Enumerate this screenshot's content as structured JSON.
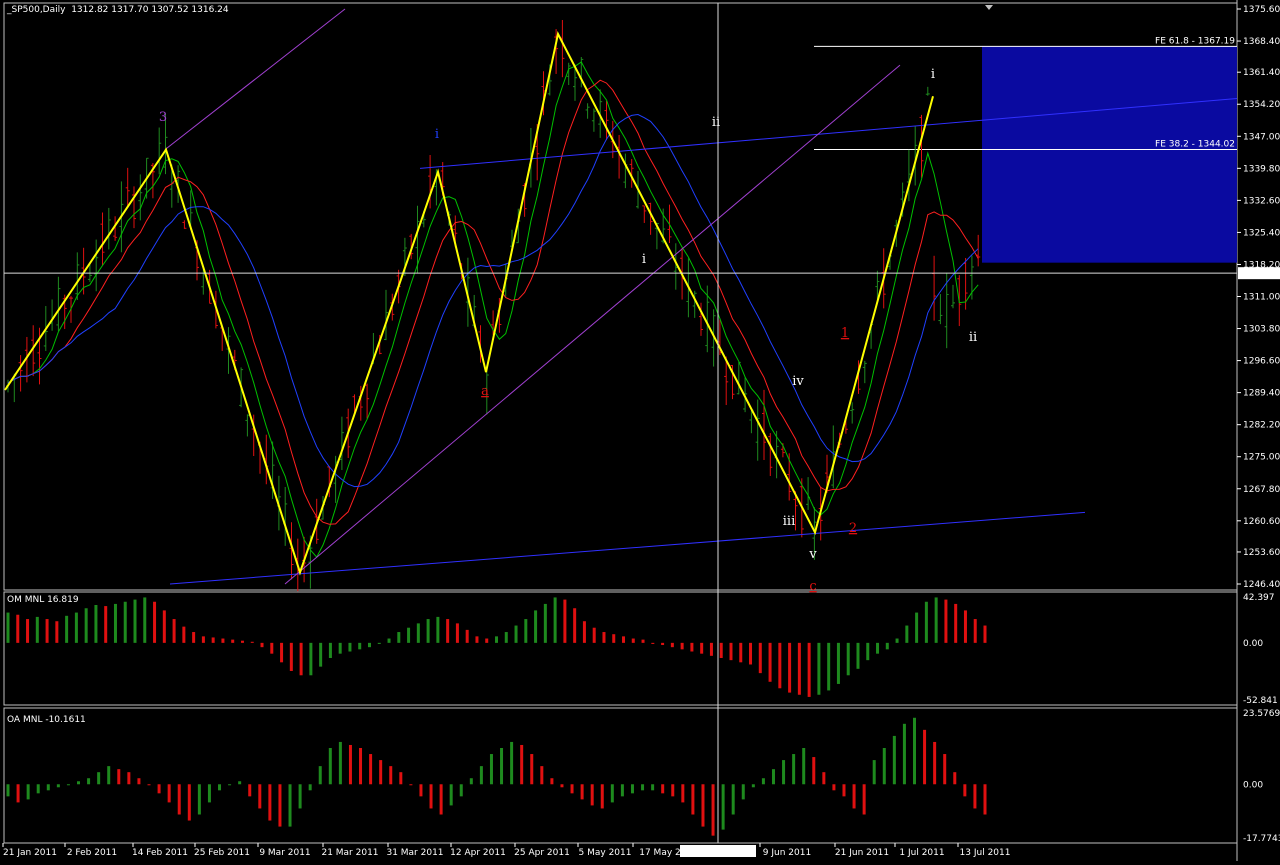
{
  "header": {
    "symbol": "_SP500,Daily",
    "ohlc": "1312.82 1317.70 1307.52 1316.24"
  },
  "indicators": {
    "om_label": "OM MNL 16.819",
    "oa_label": "OA MNL -10.1611"
  },
  "crosshair_time": "2011.05.31 0:00",
  "colors": {
    "background": "#000000",
    "frame": "#c0c0c0",
    "bull_bar": "#1f8a1f",
    "bear_bar": "#e01010",
    "zigzag": "#ffff00",
    "ma_fast": "#00c000",
    "ma_mid": "#ff2020",
    "ma_slow": "#2040ff",
    "channel": "#3030ff",
    "diagonal": "#a040d0",
    "fib_zone": "#0a0aa0",
    "hist_pos": "#1e8a1e",
    "hist_neg": "#e01010"
  },
  "chart_data": [
    {
      "type": "candlestick",
      "pane": "price",
      "title": "_SP500,Daily",
      "y_ticks": [
        "1375.60",
        "1368.40",
        "1361.40",
        "1354.20",
        "1347.00",
        "1339.80",
        "1332.60",
        "1325.40",
        "1318.20",
        "1311.00",
        "1303.80",
        "1296.60",
        "1289.40",
        "1282.20",
        "1275.00",
        "1267.80",
        "1260.60",
        "1253.60",
        "1246.40"
      ],
      "last_price": "1316.24",
      "x_ticks": [
        "21 Jan 2011",
        "2 Feb 2011",
        "14 Feb 2011",
        "25 Feb 2011",
        "9 Mar 2011",
        "21 Mar 2011",
        "31 Mar 2011",
        "12 Apr 2011",
        "25 Apr 2011",
        "5 May 2011",
        "17 May 2",
        "9 Jun 2011",
        "21 Jun 2011",
        "1 Jul 2011",
        "13 Jul 2011"
      ],
      "zigzag": [
        {
          "date": "19 Jan 2011",
          "price": 1290
        },
        {
          "date": "18 Feb 2011",
          "price": 1344
        },
        {
          "date": "16 Mar 2011",
          "price": 1249
        },
        {
          "date": "1 Apr 2011",
          "price": 1339
        },
        {
          "date": "18 Apr 2011",
          "price": 1294
        },
        {
          "date": "2 May 2011",
          "price": 1370
        },
        {
          "date": "16 Jun 2011",
          "price": 1258
        },
        {
          "date": "7 Jul 2011",
          "price": 1356
        }
      ],
      "fibonacci": [
        {
          "label": "FE 61.8 - 1367.19",
          "price": 1367.19
        },
        {
          "label": "FE 38.2 - 1344.02",
          "price": 1344.02
        }
      ],
      "wave_labels": [
        {
          "text": "3",
          "color": "#a040d0"
        },
        {
          "text": "i",
          "color": "#2040ff"
        },
        {
          "text": "a",
          "color": "#e01010"
        },
        {
          "text": "ii",
          "color": "#ffffff"
        },
        {
          "text": "i",
          "color": "#ffffff"
        },
        {
          "text": "iv",
          "color": "#ffffff"
        },
        {
          "text": "iii",
          "color": "#ffffff"
        },
        {
          "text": "v",
          "color": "#ffffff"
        },
        {
          "text": "1",
          "color": "#e01010"
        },
        {
          "text": "2",
          "color": "#e01010"
        },
        {
          "text": "c",
          "color": "#e01010"
        },
        {
          "text": "i",
          "color": "#ffffff"
        },
        {
          "text": "ii",
          "color": "#ffffff"
        }
      ],
      "series": [
        {
          "values": []
        },
        {
          "values": []
        },
        {
          "values": []
        }
      ]
    },
    {
      "type": "bar",
      "pane": "OM",
      "title": "OM MNL 16.819",
      "y_ticks": [
        "42.397",
        "0.00",
        "-52.841"
      ],
      "ylim": [
        -52.841,
        42.397
      ],
      "values": [
        28,
        26,
        22,
        24,
        22,
        20,
        25,
        28,
        32,
        35,
        34,
        36,
        38,
        40,
        42,
        38,
        30,
        22,
        15,
        10,
        6,
        5,
        4,
        3,
        2,
        1,
        -4,
        -10,
        -18,
        -26,
        -30,
        -30,
        -22,
        -14,
        -10,
        -8,
        -6,
        -4,
        -1,
        4,
        10,
        14,
        18,
        22,
        24,
        22,
        18,
        12,
        6,
        4,
        6,
        10,
        16,
        22,
        30,
        36,
        42,
        40,
        32,
        20,
        14,
        10,
        8,
        6,
        4,
        3,
        -1,
        -2,
        -4,
        -6,
        -8,
        -10,
        -12,
        -14,
        -16,
        -18,
        -20,
        -28,
        -36,
        -42,
        -46,
        -48,
        -50,
        -48,
        -44,
        -38,
        -30,
        -24,
        -16,
        -10,
        -6,
        4,
        16,
        28,
        38,
        42,
        40,
        36,
        30,
        22,
        16
      ]
    },
    {
      "type": "bar",
      "pane": "OA",
      "title": "OA MNL -10.1611",
      "y_ticks": [
        "23.5769",
        "0.00",
        "-17.7743"
      ],
      "ylim": [
        -17.7743,
        23.5769
      ],
      "values": [
        -4,
        -6,
        -5,
        -3,
        -2,
        -1,
        0,
        1,
        2,
        4,
        6,
        5,
        4,
        2,
        0,
        -3,
        -6,
        -10,
        -12,
        -10,
        -6,
        -2,
        0,
        1,
        -4,
        -8,
        -12,
        -14,
        -14,
        -8,
        -2,
        6,
        12,
        14,
        13,
        12,
        10,
        8,
        6,
        4,
        0,
        -4,
        -8,
        -10,
        -7,
        -4,
        2,
        6,
        10,
        12,
        14,
        13,
        10,
        6,
        2,
        -1,
        -3,
        -5,
        -7,
        -8,
        -6,
        -4,
        -3,
        -2,
        -2,
        -3,
        -4,
        -6,
        -10,
        -14,
        -17,
        -15,
        -10,
        -5,
        -1,
        2,
        5,
        8,
        10,
        12,
        9,
        4,
        -2,
        -4,
        -8,
        -10,
        8,
        12,
        16,
        20,
        22,
        18,
        14,
        10,
        4,
        -4,
        -8,
        -10
      ]
    }
  ]
}
